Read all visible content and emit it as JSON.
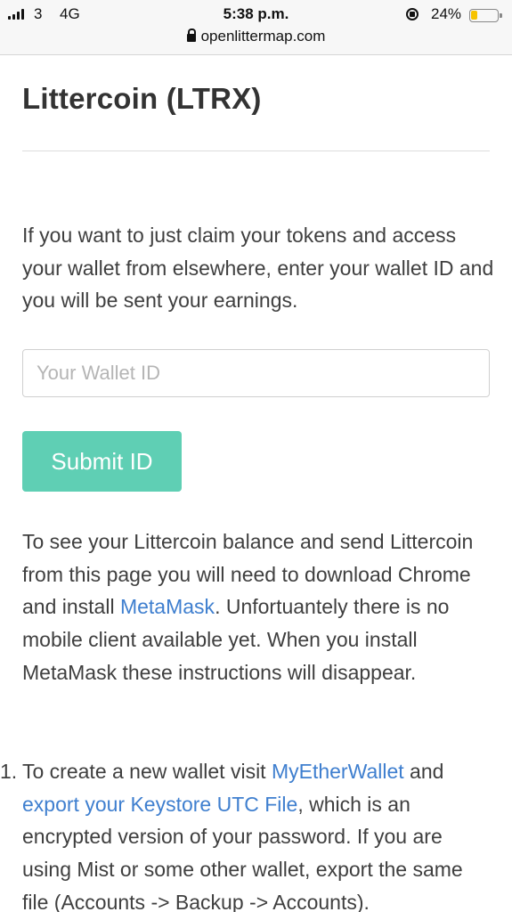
{
  "status_bar": {
    "carrier": "3",
    "network": "4G",
    "time": "5:38 p.m.",
    "battery_percent": "24%",
    "battery_level": 0.24,
    "url": "openlittermap.com"
  },
  "page": {
    "title": "Littercoin (LTRX)",
    "intro_text": "If you want to just claim your tokens and access your wallet from elsewhere, enter your wallet ID and you will be sent your earnings.",
    "wallet_input": {
      "placeholder": "Your Wallet ID",
      "value": ""
    },
    "submit_label": "Submit ID",
    "balance_text": {
      "before_link": "To see your Littercoin balance and send Littercoin from this page you will need to download Chrome and install ",
      "link": "MetaMask",
      "after_link": ". Unfortuantely there is no mobile client available yet. When you install MetaMask these instructions will disappear."
    },
    "steps": [
      {
        "number": "1.",
        "text_1": "To create a new wallet visit ",
        "link_1": "MyEtherWallet",
        "text_2": " and ",
        "link_2": "export your Keystore UTC File",
        "text_3": ", which is an encrypted version of your password. If you are using Mist or some other wallet, export the same file (Accounts -> Backup -> Accounts)."
      }
    ]
  },
  "colors": {
    "accent_button": "#5fcfb4",
    "link": "#3f7fcf",
    "battery": "#f7c300"
  }
}
